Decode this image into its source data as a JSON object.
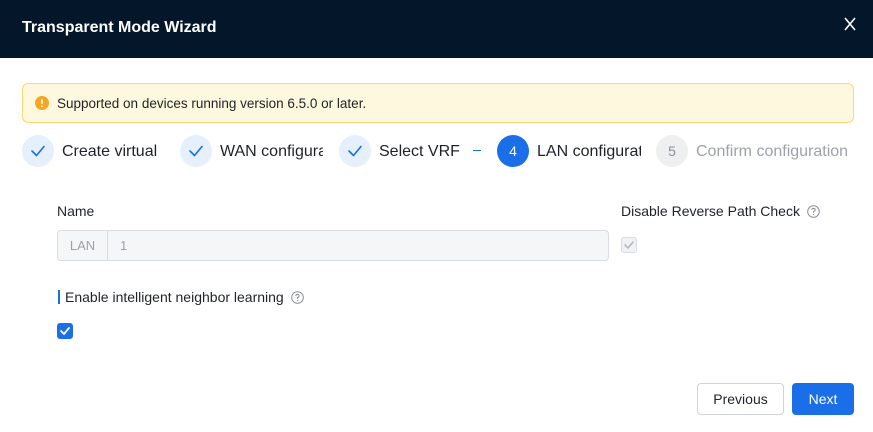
{
  "dialog": {
    "title": "Transparent Mode Wizard"
  },
  "notice": {
    "text": "Supported on devices running version 6.5.0 or later."
  },
  "steps": [
    {
      "number": "1",
      "label": "Create virtual",
      "status": "done"
    },
    {
      "number": "2",
      "label": "WAN configuration",
      "status": "done"
    },
    {
      "number": "3",
      "label": "Select VRF",
      "status": "done"
    },
    {
      "number": "4",
      "label": "LAN configuration",
      "status": "active"
    },
    {
      "number": "5",
      "label": "Confirm configuration",
      "status": "pending"
    }
  ],
  "form": {
    "name_label": "Name",
    "name_prefix": "LAN",
    "name_value": "1",
    "reverse_path_label": "Disable Reverse Path Check",
    "reverse_path_checked": true,
    "neighbor_learning_label": "Enable intelligent neighbor learning",
    "neighbor_learning_checked": true
  },
  "footer": {
    "previous_label": "Previous",
    "next_label": "Next"
  },
  "colors": {
    "header_bg": "#04172a",
    "accent": "#1a6ee8",
    "notice_bg": "#fef8df",
    "warning": "#f5a623"
  }
}
